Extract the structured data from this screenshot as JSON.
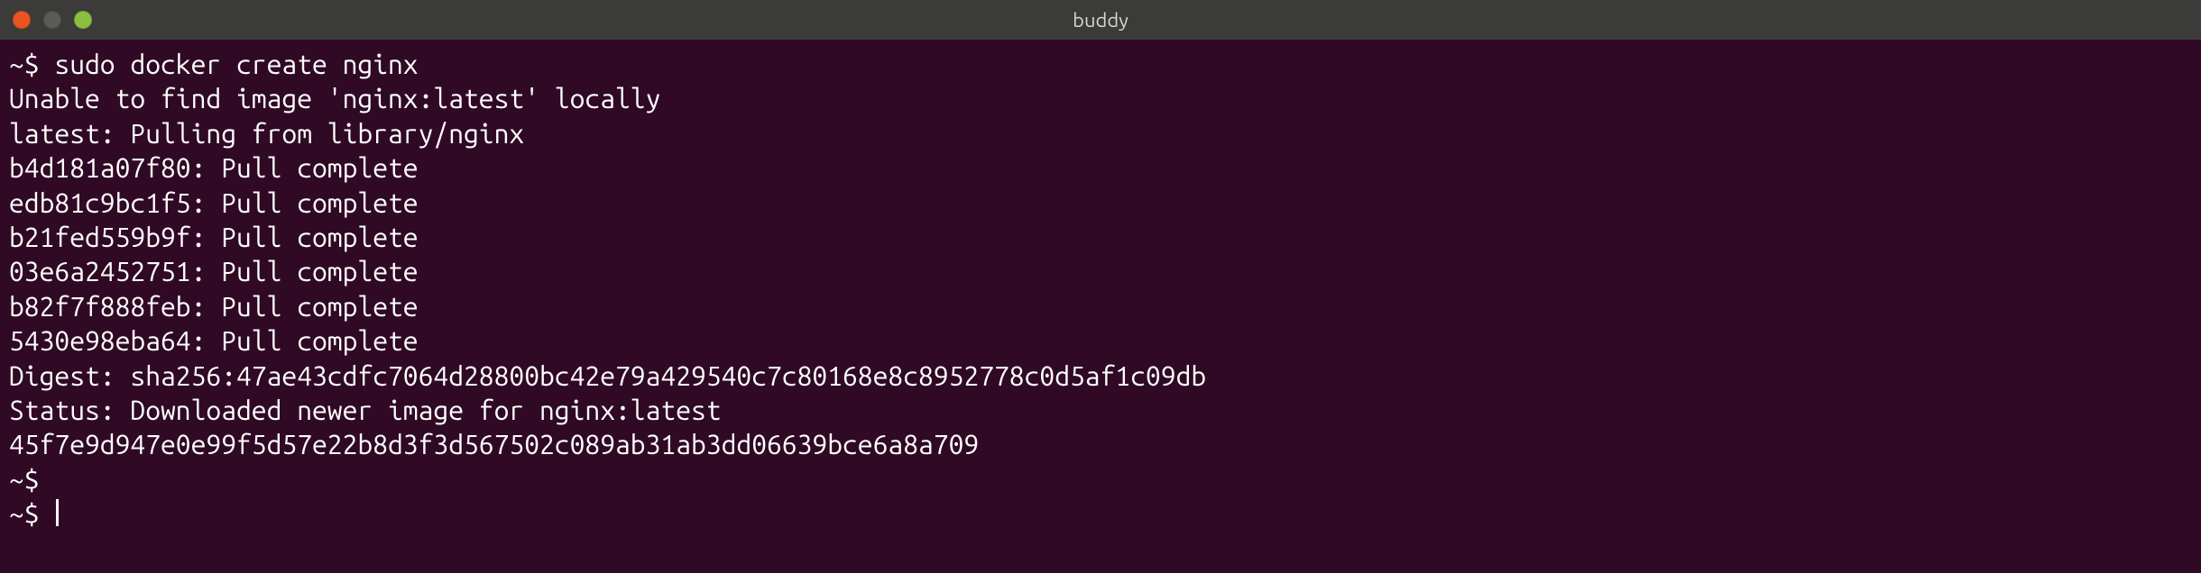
{
  "window": {
    "title": "buddy"
  },
  "terminal": {
    "prompt": "~$ ",
    "lines": {
      "l0_cmd": "sudo docker create nginx",
      "l1": "Unable to find image 'nginx:latest' locally",
      "l2": "latest: Pulling from library/nginx",
      "l3": "b4d181a07f80: Pull complete",
      "l4": "edb81c9bc1f5: Pull complete",
      "l5": "b21fed559b9f: Pull complete",
      "l6": "03e6a2452751: Pull complete",
      "l7": "b82f7f888feb: Pull complete",
      "l8": "5430e98eba64: Pull complete",
      "l9": "Digest: sha256:47ae43cdfc7064d28800bc42e79a429540c7c80168e8c8952778c0d5af1c09db",
      "l10": "Status: Downloaded newer image for nginx:latest",
      "l11": "45f7e9d947e0e99f5d57e22b8d3f3d567502c089ab31ab3dd06639bce6a8a709"
    }
  }
}
